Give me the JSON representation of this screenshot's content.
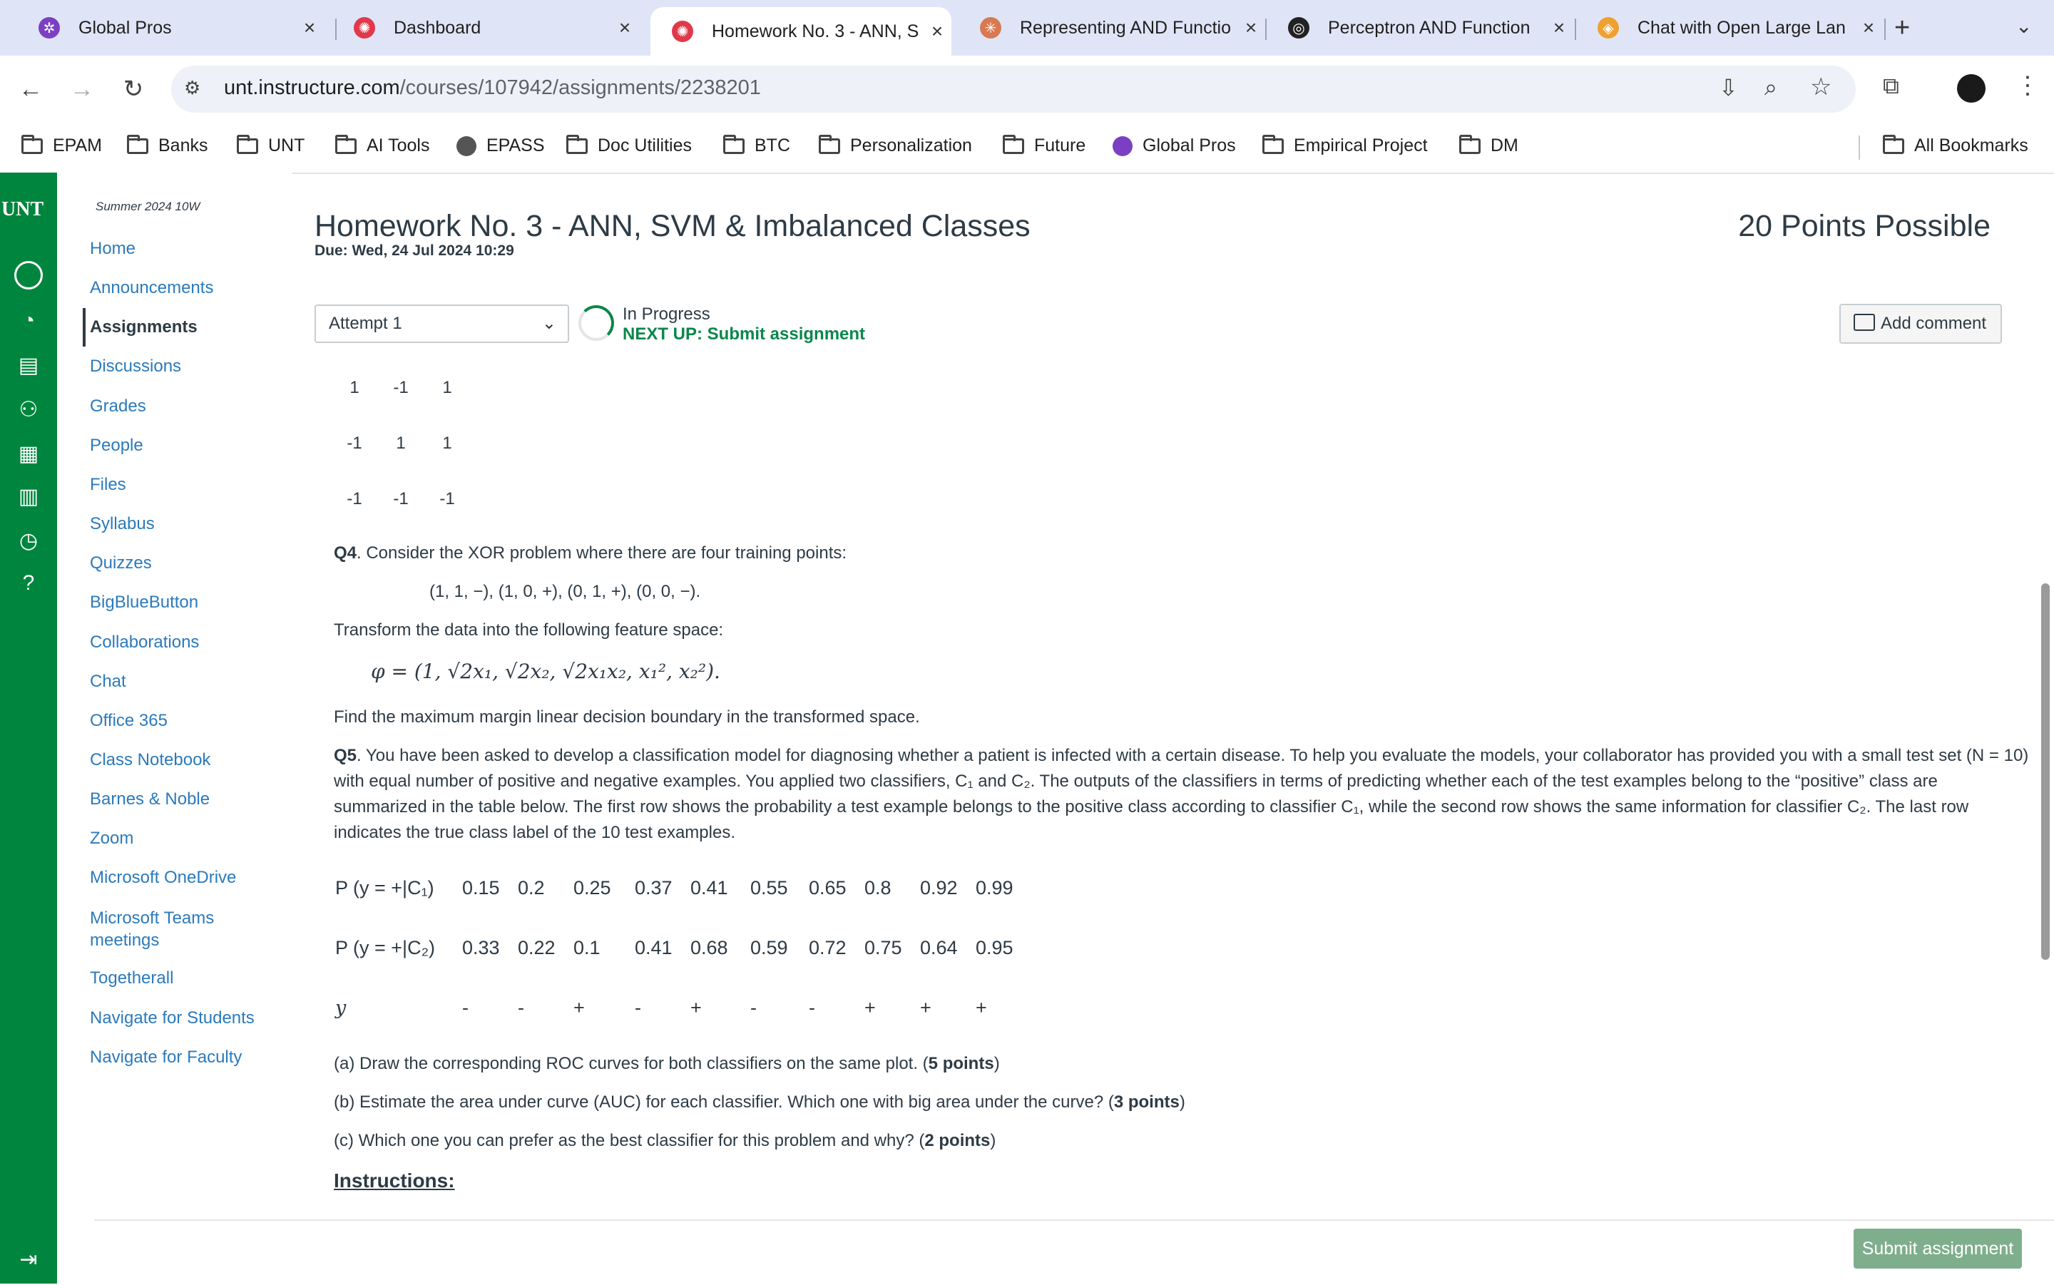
{
  "browser": {
    "tabs": [
      {
        "title": "Global Pros",
        "active": false
      },
      {
        "title": "Dashboard",
        "active": false
      },
      {
        "title": "Homework No. 3 - ANN, S",
        "active": true
      },
      {
        "title": "Representing AND Functio",
        "active": false
      },
      {
        "title": "Perceptron AND Function",
        "active": false
      },
      {
        "title": "Chat with Open Large Lan",
        "active": false
      }
    ],
    "url_host": "unt.instructure.com",
    "url_path": "/courses/107942/assignments/2238201",
    "bookmarks": [
      "EPAM",
      "Banks",
      "UNT",
      "AI Tools",
      "EPASS",
      "Doc Utilities",
      "BTC",
      "Personalization",
      "Future",
      "Global Pros",
      "Empirical Project",
      "DM"
    ],
    "all_bookmarks": "All Bookmarks"
  },
  "global_nav": {
    "logo": "UNT"
  },
  "course_nav": {
    "term": "Summer 2024 10W",
    "items": [
      "Home",
      "Announcements",
      "Assignments",
      "Discussions",
      "Grades",
      "People",
      "Files",
      "Syllabus",
      "Quizzes",
      "BigBlueButton",
      "Collaborations",
      "Chat",
      "Office 365",
      "Class Notebook",
      "Barnes & Noble",
      "Zoom",
      "Microsoft OneDrive",
      "Microsoft Teams meetings",
      "Togetherall",
      "Navigate for Students",
      "Navigate for Faculty"
    ],
    "selected": "Assignments"
  },
  "assignment": {
    "title": "Homework No. 3 - ANN, SVM & Imbalanced Classes",
    "due": "Due: Wed, 24 Jul 2024 10:29",
    "points": "20 Points Possible",
    "attempt": "Attempt 1",
    "status": "In Progress",
    "next_up": "NEXT UP: Submit assignment",
    "add_comment": "Add comment",
    "submit": "Submit assignment"
  },
  "matrix_rows": [
    [
      "1",
      "-1",
      "1"
    ],
    [
      "-1",
      "1",
      "1"
    ],
    [
      "-1",
      "-1",
      "-1"
    ]
  ],
  "q4": {
    "label": "Q4",
    "text": ". Consider the XOR problem where there are four training points:",
    "points": "(1, 1, −), (1, 0, +), (0, 1, +), (0, 0, −).",
    "transform": "Transform the data into the following feature space:",
    "formula": "φ = (1, √2x₁, √2x₂, √2x₁x₂, x₁², x₂²).",
    "find": "Find the maximum margin linear decision boundary in the transformed space."
  },
  "q5": {
    "label": "Q5",
    "line1": ". You have been asked to develop a classification model for diagnosing whether a patient is infected with a certain disease. To help you evaluate the models, your collaborator has provided you with a small test set (N = 10)",
    "line2": "with equal number of positive and negative examples. You applied two classifiers, C₁ and C₂. The outputs of the classifiers in terms of predicting whether each of the test examples belong to the “positive” class are",
    "line3": "summarized in the table below. The first row shows the probability a test example belongs to the positive class according to classifier C₁, while the second row shows the same information for classifier C₂. The last row",
    "line4": "indicates the true class label of the 10 test examples.",
    "table": {
      "row_labels": [
        "P (y = +|C₁)",
        "P (y = +|C₂)",
        "y"
      ],
      "c1": [
        "0.15",
        "0.2",
        "0.25",
        "0.37",
        "0.41",
        "0.55",
        "0.65",
        "0.8",
        "0.92",
        "0.99"
      ],
      "c2": [
        "0.33",
        "0.22",
        "0.1",
        "0.41",
        "0.68",
        "0.59",
        "0.72",
        "0.75",
        "0.64",
        "0.95"
      ],
      "y": [
        "-",
        "-",
        "+",
        "-",
        "+",
        "-",
        "-",
        "+",
        "+",
        "+"
      ]
    },
    "a": "(a) Draw the corresponding ROC curves for both classifiers on the same plot. (",
    "a_pts": "5 points",
    "b": "(b) Estimate the area under curve (AUC) for each classifier. Which one with big area under the curve? (",
    "b_pts": "3 points",
    "c": "(c) Which one you can prefer as the best classifier for this problem and why? (",
    "c_pts": "2 points",
    "close": ")"
  },
  "instructions": "Instructions:"
}
